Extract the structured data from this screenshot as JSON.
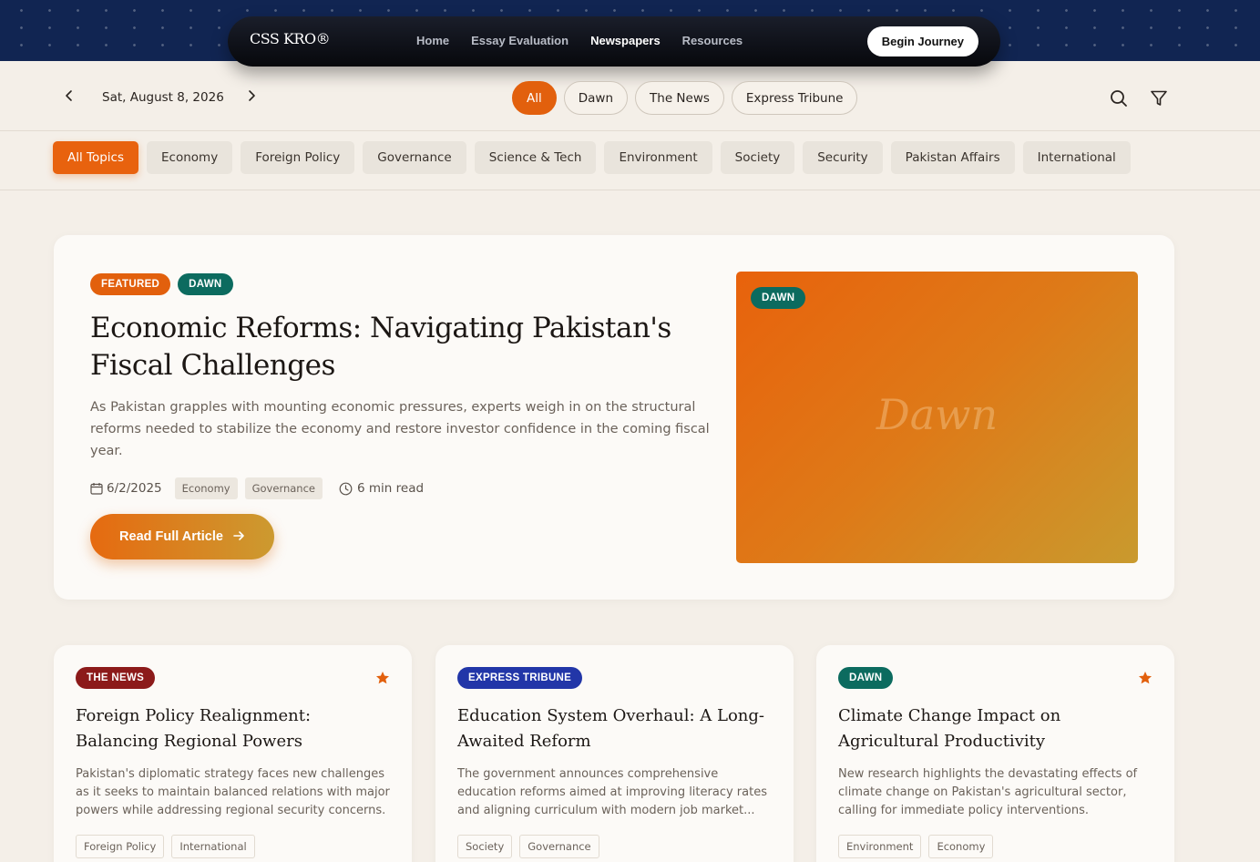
{
  "nav": {
    "logo": "CSS KRO®",
    "links": [
      "Home",
      "Essay Evaluation",
      "Newspapers",
      "Resources"
    ],
    "active_link": "Newspapers",
    "cta_label": "Begin Journey"
  },
  "toolbar": {
    "date": "Sat, August 8, 2026",
    "sources": [
      "All",
      "Dawn",
      "The News",
      "Express Tribune"
    ],
    "active_source": "All"
  },
  "topics": {
    "items": [
      "All Topics",
      "Economy",
      "Foreign Policy",
      "Governance",
      "Science & Tech",
      "Environment",
      "Society",
      "Security",
      "Pakistan Affairs",
      "International"
    ],
    "active": "All Topics"
  },
  "featured": {
    "badge_featured": "FEATURED",
    "badge_source": "DAWN",
    "title": "Economic Reforms: Navigating Pakistan's Fiscal Challenges",
    "summary": "As Pakistan grapples with mounting economic pressures, experts weigh in on the structural reforms needed to stabilize the economy and restore investor confidence in the coming fiscal year.",
    "date": "6/2/2025",
    "tags": [
      "Economy",
      "Governance"
    ],
    "read_time": "6 min read",
    "read_button": "Read Full Article",
    "image_badge": "DAWN",
    "image_word": "Dawn"
  },
  "cards": [
    {
      "badge": "THE NEWS",
      "title": "Foreign Policy Realignment: Balancing Regional Powers",
      "summary": "Pakistan's diplomatic strategy faces new challenges as it seeks to maintain balanced relations with major powers while addressing regional security concerns.",
      "tags": [
        "Foreign Policy",
        "International"
      ],
      "starred": true
    },
    {
      "badge": "EXPRESS TRIBUNE",
      "title": "Education System Overhaul: A Long-Awaited Reform",
      "summary": "The government announces comprehensive education reforms aimed at improving literacy rates and aligning curriculum with modern job market...",
      "tags": [
        "Society",
        "Governance"
      ],
      "starred": false
    },
    {
      "badge": "DAWN",
      "title": "Climate Change Impact on Agricultural Productivity",
      "summary": "New research highlights the devastating effects of climate change on Pakistan's agricultural sector, calling for immediate policy interventions.",
      "tags": [
        "Environment",
        "Economy"
      ],
      "starred": true
    }
  ],
  "colors": {
    "accent": "#e2600d",
    "dawn": "#0c6b5f",
    "the_news": "#8c1a1a",
    "express_tribune": "#2236a8"
  }
}
